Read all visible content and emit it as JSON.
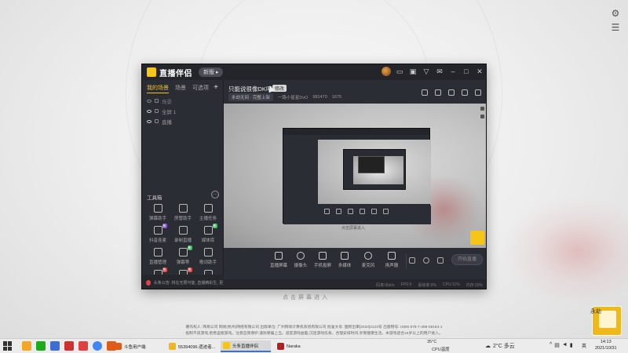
{
  "app": {
    "logo_text": "直播伴侣",
    "version_pill": "新版 ▸"
  },
  "left_tabs": [
    "我的场景",
    "场景",
    "可选项"
  ],
  "add_scene": "+",
  "scenes": [
    {
      "name": "场景",
      "state": "off"
    },
    {
      "name": "全屏 1",
      "state": "on"
    },
    {
      "name": "直播",
      "state": "on"
    }
  ],
  "tools": {
    "title": "工具箱",
    "more": "···",
    "items": [
      {
        "label": "弹幕助手",
        "badge": ""
      },
      {
        "label": "房管助手",
        "badge": ""
      },
      {
        "label": "主播任务",
        "badge": ""
      },
      {
        "label": "抖音连麦",
        "badge": "新"
      },
      {
        "label": "录制直播",
        "badge": ""
      },
      {
        "label": "媒体库",
        "badge": "新"
      },
      {
        "label": "直播管理",
        "badge": ""
      },
      {
        "label": "弹幕等",
        "badge": "新"
      },
      {
        "label": "歌词助手",
        "badge": ""
      },
      {
        "label": "投屏",
        "badge": "热"
      },
      {
        "label": "",
        "badge": "热"
      },
      {
        "label": "",
        "badge": ""
      }
    ]
  },
  "notice": "头条公告: 将在无限可能, 直播精彩生, 更上一层楼",
  "stream": {
    "title": "只能说很像DK吧。",
    "modify_chip": "修改",
    "meta": [
      "永劫无间 · 完整上架",
      "一路小星星DvO",
      "981470",
      "1675"
    ]
  },
  "toolbar": [
    "直播屏幕",
    "摄像头",
    "手机投屏",
    "多媒体",
    "麦克风",
    "扬声器"
  ],
  "start_button": "开始直播",
  "statusbar": [
    "码率:0kb/s",
    "FPS:0",
    "丢帧率:0%",
    "CPU:11%",
    "内存:29%"
  ],
  "hint": "点击屏幕进入",
  "footer": {
    "line1": "著作权人: 网易公司 网易(杭州)网络有限公司 出版单位: 广州网易计算机系统有限公司 批准文号: 国新出审[2020]2123号 出版物号: ISBN 978-7-498-08184-1",
    "line2": "抵制不良游戏,拒绝盗版游戏。注意自我保护,谨防受骗上当。适度游戏益脑,沉迷游戏伤身。合理安排时间,享受健康生活。本游戏适合16岁以上的用户进入。"
  },
  "corner_text": "永劫",
  "taskbar": {
    "tasks": [
      {
        "label": "斗鱼用户端",
        "color": "#e05a1a"
      },
      {
        "label": "55394096-遗迹者...",
        "color": "#f0b818"
      },
      {
        "label": "头条直播伴侣",
        "color": "#f5c518",
        "active": true
      },
      {
        "label": "Naraka",
        "color": "#b02020"
      }
    ],
    "temp": "35°C",
    "cpu": "CPU温度",
    "weather": "2°C 多云",
    "lang": "英",
    "time": "14:13",
    "date": "2021/10/31"
  }
}
